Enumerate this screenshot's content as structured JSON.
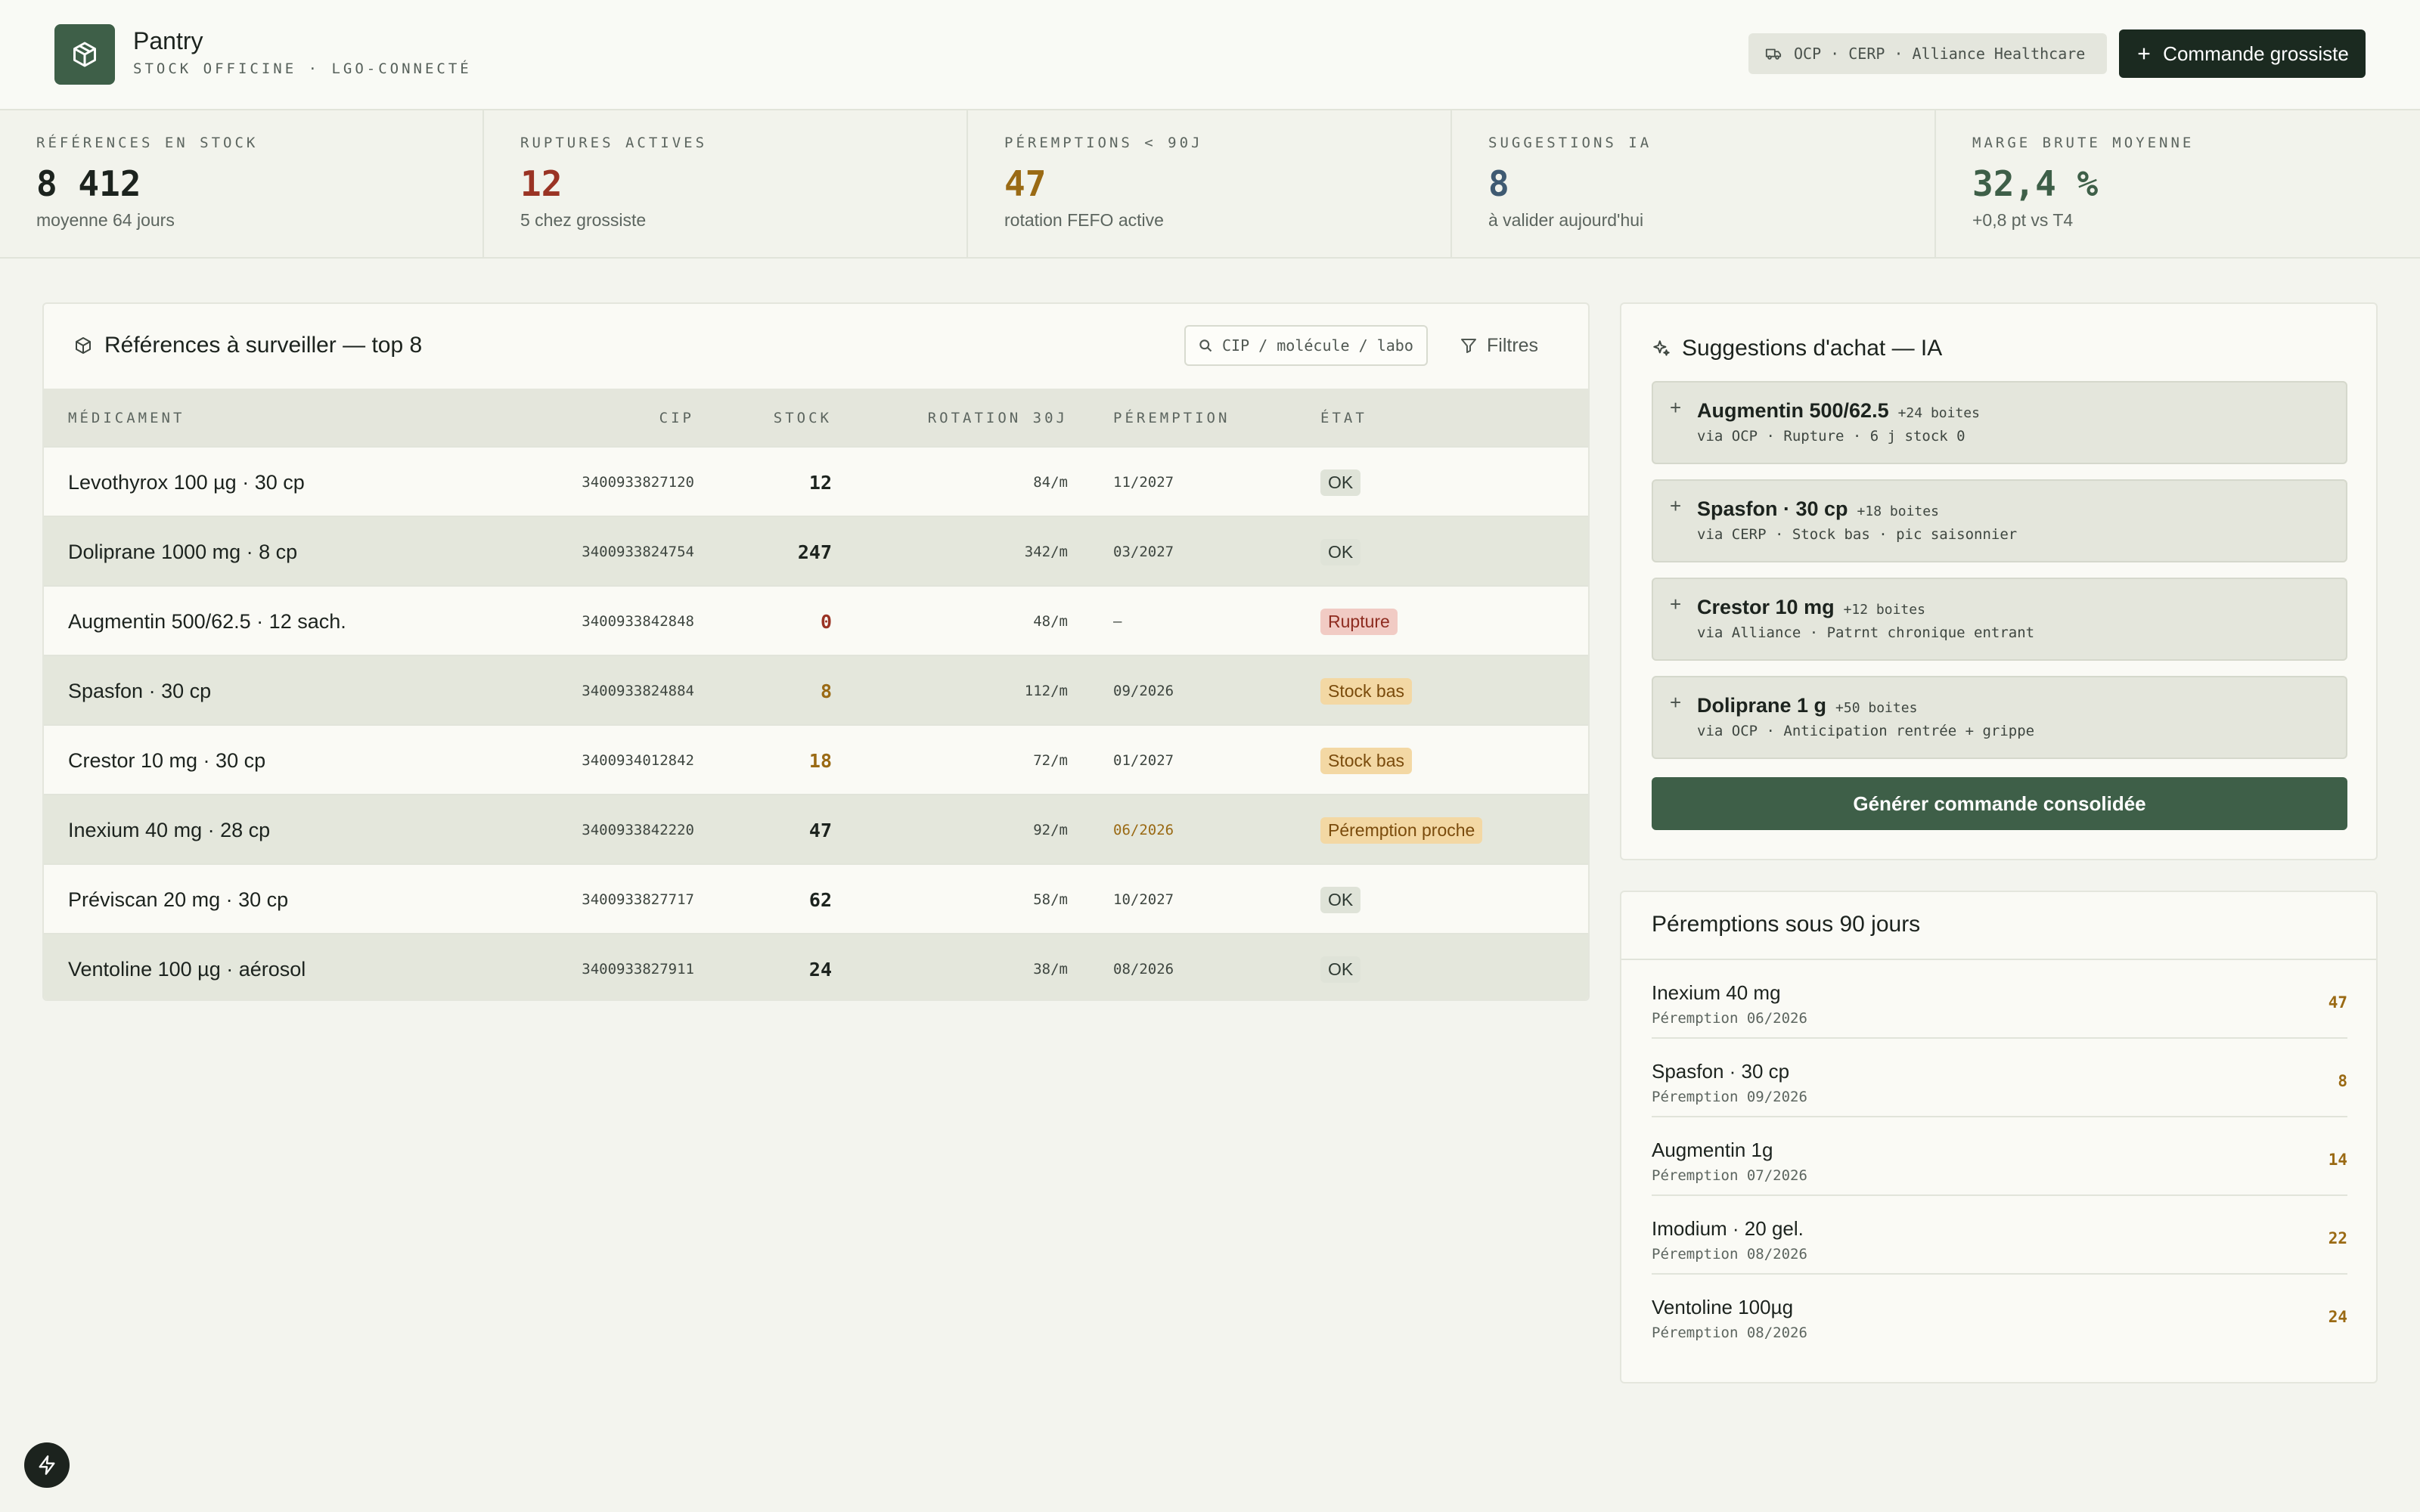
{
  "header": {
    "app_name": "Pantry",
    "app_sub": "STOCK OFFICINE · LGO-CONNECTÉ",
    "suppliers": "OCP · CERP · Alliance Healthcare",
    "order_button": "Commande grossiste"
  },
  "kpis": [
    {
      "label": "RÉFÉRENCES EN STOCK",
      "value": "8 412",
      "sub": "moyenne 64 jours",
      "color": "#1c231e"
    },
    {
      "label": "RUPTURES ACTIVES",
      "value": "12",
      "sub": "5 chez grossiste",
      "color": "#9a3324"
    },
    {
      "label": "PÉREMPTIONS < 90J",
      "value": "47",
      "sub": "rotation FEFO active",
      "color": "#9a6a14"
    },
    {
      "label": "SUGGESTIONS IA",
      "value": "8",
      "sub": "à valider aujourd'hui",
      "color": "#3f5a72"
    },
    {
      "label": "MARGE BRUTE MOYENNE",
      "value": "32,4 %",
      "sub": "+0,8 pt vs T4",
      "color": "#3e5f48"
    }
  ],
  "watch": {
    "title": "Références à surveiller — top 8",
    "search_placeholder": "CIP / molécule / labo",
    "filters_label": "Filtres",
    "columns": {
      "name": "MÉDICAMENT",
      "cip": "CIP",
      "stock": "STOCK",
      "rotation": "ROTATION 30J",
      "expiry": "PÉREMPTION",
      "state": "ÉTAT"
    },
    "rows": [
      {
        "name": "Levothyrox 100 µg · 30 cp",
        "cip": "3400933827120",
        "stock": "12",
        "stock_color": "#1c231e",
        "rotation": "84/m",
        "expiry": "11/2027",
        "expiry_color": "#3e4640",
        "state": "OK",
        "state_kind": "ok"
      },
      {
        "name": "Doliprane 1000 mg · 8 cp",
        "cip": "3400933824754",
        "stock": "247",
        "stock_color": "#1c231e",
        "rotation": "342/m",
        "expiry": "03/2027",
        "expiry_color": "#3e4640",
        "state": "OK",
        "state_kind": "ok"
      },
      {
        "name": "Augmentin 500/62.5 · 12 sach.",
        "cip": "3400933842848",
        "stock": "0",
        "stock_color": "#9a3324",
        "rotation": "48/m",
        "expiry": "—",
        "expiry_color": "#3e4640",
        "state": "Rupture",
        "state_kind": "rupture"
      },
      {
        "name": "Spasfon · 30 cp",
        "cip": "3400933824884",
        "stock": "8",
        "stock_color": "#9a6a14",
        "rotation": "112/m",
        "expiry": "09/2026",
        "expiry_color": "#3e4640",
        "state": "Stock bas",
        "state_kind": "low"
      },
      {
        "name": "Crestor 10 mg · 30 cp",
        "cip": "3400934012842",
        "stock": "18",
        "stock_color": "#9a6a14",
        "rotation": "72/m",
        "expiry": "01/2027",
        "expiry_color": "#3e4640",
        "state": "Stock bas",
        "state_kind": "low"
      },
      {
        "name": "Inexium 40 mg · 28 cp",
        "cip": "3400933842220",
        "stock": "47",
        "stock_color": "#1c231e",
        "rotation": "92/m",
        "expiry": "06/2026",
        "expiry_color": "#9a6a14",
        "state": "Péremption proche",
        "state_kind": "exp"
      },
      {
        "name": "Préviscan 20 mg · 30 cp",
        "cip": "3400933827717",
        "stock": "62",
        "stock_color": "#1c231e",
        "rotation": "58/m",
        "expiry": "10/2027",
        "expiry_color": "#3e4640",
        "state": "OK",
        "state_kind": "ok"
      },
      {
        "name": "Ventoline 100 µg · aérosol",
        "cip": "3400933827911",
        "stock": "24",
        "stock_color": "#1c231e",
        "rotation": "38/m",
        "expiry": "08/2026",
        "expiry_color": "#3e4640",
        "state": "OK",
        "state_kind": "ok"
      }
    ]
  },
  "suggestions": {
    "title": "Suggestions d'achat — IA",
    "items": [
      {
        "name": "Augmentin 500/62.5",
        "qty": "+24 boites",
        "via": "via OCP · Rupture · 6 j stock 0"
      },
      {
        "name": "Spasfon · 30 cp",
        "qty": "+18 boites",
        "via": "via CERP · Stock bas · pic saisonnier"
      },
      {
        "name": "Crestor 10 mg",
        "qty": "+12 boites",
        "via": "via Alliance · Patrnt chronique entrant"
      },
      {
        "name": "Doliprane 1 g",
        "qty": "+50 boites",
        "via": "via OCP · Anticipation rentrée + grippe"
      }
    ],
    "generate_button": "Générer commande consolidée"
  },
  "expirations": {
    "title": "Péremptions sous 90 jours",
    "items": [
      {
        "name": "Inexium 40 mg",
        "date": "Péremption 06/2026",
        "qty": "47"
      },
      {
        "name": "Spasfon · 30 cp",
        "date": "Péremption 09/2026",
        "qty": "8"
      },
      {
        "name": "Augmentin 1g",
        "date": "Péremption 07/2026",
        "qty": "14"
      },
      {
        "name": "Imodium · 20 gel.",
        "date": "Péremption 08/2026",
        "qty": "22"
      },
      {
        "name": "Ventoline 100µg",
        "date": "Péremption 08/2026",
        "qty": "24"
      }
    ]
  }
}
